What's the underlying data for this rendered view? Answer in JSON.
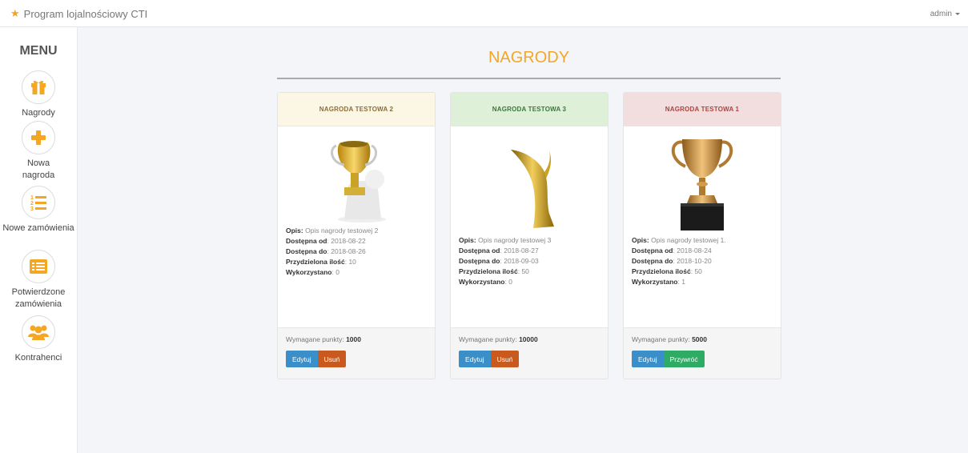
{
  "topbar": {
    "brand": "Program lojalnościowy CTI",
    "user": "admin"
  },
  "sidebar": {
    "title": "MENU",
    "items": [
      {
        "icon": "gift-icon",
        "label": "Nagrody"
      },
      {
        "icon": "plus-icon",
        "label": "Nowa nagroda"
      },
      {
        "icon": "ordered-list-icon",
        "label": "Nowe zamówienia"
      },
      {
        "icon": "list-card-icon",
        "label": "Potwierdzone zamówienia"
      },
      {
        "icon": "users-icon",
        "label": "Kontrahenci"
      }
    ]
  },
  "main": {
    "title": "NAGRODY"
  },
  "labels": {
    "desc": "Opis:",
    "from": "Dostępna od",
    "to": "Dostępna do",
    "qty": "Przydzielona ilość",
    "used": "Wykorzystano",
    "points": "Wymagane punkty:"
  },
  "cards": [
    {
      "title": "NAGRODA TESTOWA 2",
      "desc": "Opis nagrody testowej 2",
      "from": "2018-08-22",
      "to": "2018-08-26",
      "qty": "10",
      "used": "0",
      "points": "1000",
      "edit": "Edytuj",
      "action": "Usuń",
      "header_bg": "#fcf7e4",
      "header_color": "#8a6d3b",
      "icon": "trophy-person-icon"
    },
    {
      "title": "NAGRODA TESTOWA 3",
      "desc": "Opis nagrody testowej 3",
      "from": "2018-08-27",
      "to": "2018-09-03",
      "qty": "50",
      "used": "0",
      "points": "10000",
      "edit": "Edytuj",
      "action": "Usuń",
      "header_bg": "#dff0d8",
      "header_color": "#3c763d",
      "icon": "gold-award-icon"
    },
    {
      "title": "NAGRODA TESTOWA 1",
      "desc": "Opis nagrody testowej 1.",
      "from": "2018-08-24",
      "to": "2018-10-20",
      "qty": "50",
      "used": "1",
      "points": "5000",
      "edit": "Edytuj",
      "action": "Przywróć",
      "header_bg": "#f2dede",
      "header_color": "#a94442",
      "icon": "trophy-cup-icon"
    }
  ],
  "colors": {
    "accent": "#f5a623",
    "edit": "#3b8fc9",
    "delete": "#c85a20",
    "restore": "#2eab64"
  }
}
